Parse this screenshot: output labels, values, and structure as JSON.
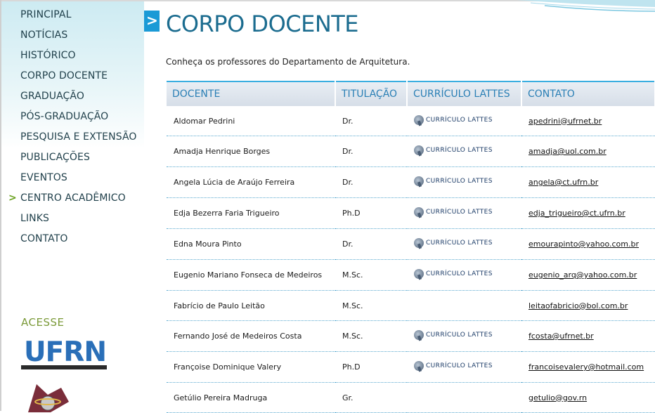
{
  "sidebar": {
    "items": [
      {
        "label": "PRINCIPAL"
      },
      {
        "label": "NOTÍCIAS"
      },
      {
        "label": "HISTÓRICO"
      },
      {
        "label": "CORPO DOCENTE"
      },
      {
        "label": "GRADUAÇÃO"
      },
      {
        "label": "PÓS-GRADUAÇÃO"
      },
      {
        "label": "PESQUISA E EXTENSÃO"
      },
      {
        "label": "PUBLICAÇÕES"
      },
      {
        "label": "EVENTOS"
      },
      {
        "label": "CENTRO ACADÊMICO",
        "active": true
      },
      {
        "label": "LINKS"
      },
      {
        "label": "CONTATO"
      }
    ],
    "acesse_label": "ACESSE",
    "ufrn_logo_text": "UFRN"
  },
  "main": {
    "title": "CORPO DOCENTE",
    "intro": "Conheça os professores do Departamento de Arquitetura.",
    "table": {
      "headers": [
        "DOCENTE",
        "TITULAÇÃO",
        "CURRÍCULO LATTES",
        "CONTATO"
      ],
      "lattes_label": "CURRÍCULO LATTES",
      "rows": [
        {
          "name": "Aldomar Pedrini",
          "title": "Dr.",
          "lattes": true,
          "email": "apedrini@ufrnet.br"
        },
        {
          "name": "Amadja Henrique Borges",
          "title": "Dr.",
          "lattes": true,
          "email": "amadja@uol.com.br"
        },
        {
          "name": "Angela Lúcia de Araújo Ferreira",
          "title": "Dr.",
          "lattes": true,
          "email": "angela@ct.ufrn.br"
        },
        {
          "name": "Edja Bezerra Faria Trigueiro",
          "title": "Ph.D",
          "lattes": true,
          "email": "edja_trigueiro@ct.ufrn.br"
        },
        {
          "name": "Edna Moura Pinto",
          "title": "Dr.",
          "lattes": true,
          "email": "emourapinto@yahoo.com.br"
        },
        {
          "name": "Eugenio Mariano Fonseca de Medeiros",
          "title": "M.Sc.",
          "lattes": true,
          "email": "eugenio_arq@yahoo.com.br"
        },
        {
          "name": "Fabrício de Paulo Leitão",
          "title": "M.Sc.",
          "lattes": false,
          "email": "leitaofabricio@bol.com.br"
        },
        {
          "name": "Fernando José de Medeiros Costa",
          "title": "M.Sc.",
          "lattes": true,
          "email": "fcosta@ufrnet.br"
        },
        {
          "name": "Françoise Dominique Valery",
          "title": "Ph.D",
          "lattes": true,
          "email": "francoisevalery@hotmail.com"
        },
        {
          "name": "Getúlio Pereira Madruga",
          "title": "Gr.",
          "lattes": false,
          "email": "getulio@gov.rn"
        }
      ]
    }
  },
  "colors": {
    "accent": "#1a9ad6",
    "title": "#1b6c8f",
    "header_text": "#2a7fb5",
    "nav_text": "#1f3f4a",
    "active_arrow": "#6aa11f"
  }
}
